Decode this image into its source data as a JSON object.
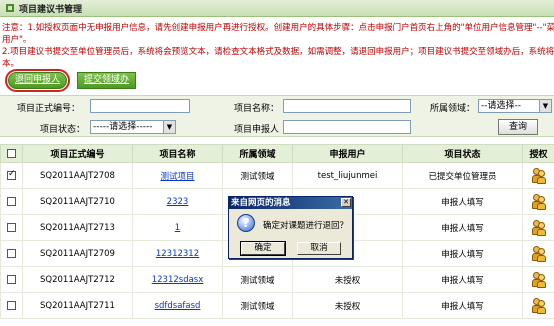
{
  "header": {
    "title": "项目建议书管理"
  },
  "notice": {
    "line1": "注意：1.如授权页面中无申报用户信息，请先创建申报用户再进行授权。创建用户的具体步骤：点击申报门户首页右上角的\"单位用户信息管理\"--\"菜单位申报",
    "line2": "用户\"。",
    "line3": "      2.项目建议书提交至单位管理员后，系统将会预览文本，请检查文本格式及数据，如需调整，请退回申报用户；项目建议书提交至领域办后，系统将",
    "line4": "本。"
  },
  "toolbar": {
    "return_label": "退回申报人",
    "submit_label": "提交领域办"
  },
  "search": {
    "code_label": "项目正式编号：",
    "name_label": "项目名称：",
    "field_label": "所属领域：",
    "field_select": "--请选择--",
    "status_label": "项目状态：",
    "status_select": "-----请选择-----",
    "applicant_label": "项目申报人",
    "query_label": "查询"
  },
  "table": {
    "headers": [
      "",
      "项目正式编号",
      "项目名称",
      "所属领域",
      "申报用户",
      "项目状态",
      "授权"
    ],
    "rows": [
      {
        "checked": true,
        "code": "SQ2011AAJT2708",
        "name": "测试项目",
        "field": "测试领域",
        "user": "test_liujunmei",
        "status": "已提交单位管理员"
      },
      {
        "checked": false,
        "code": "SQ2011AAJT2710",
        "name": "2323",
        "field": "测试领域",
        "user": "",
        "status": "申报人填写"
      },
      {
        "checked": false,
        "code": "SQ2011AAJT2713",
        "name": "1",
        "field": "",
        "user": "",
        "status": "申报人填写"
      },
      {
        "checked": false,
        "code": "SQ2011AAJT2709",
        "name": "12312312",
        "field": "",
        "user": "",
        "status": "申报人填写"
      },
      {
        "checked": false,
        "code": "SQ2011AAJT2712",
        "name": "12312sdasx",
        "field": "测试领域",
        "user": "未授权",
        "status": "申报人填写"
      },
      {
        "checked": false,
        "code": "SQ2011AAJT2711",
        "name": "sdfdsafasd",
        "field": "测试领域",
        "user": "未授权",
        "status": "申报人填写"
      }
    ]
  },
  "dialog": {
    "title": "来自网页的消息",
    "message": "确定对课题进行退回？",
    "ok_label": "确定",
    "cancel_label": "取消"
  },
  "icons": {
    "title_icon": "square-bullet-icon",
    "auth_icon": "users-icon",
    "dialog_icon": "question-icon"
  },
  "colors": {
    "accent_green": "#4c9a22",
    "notice_red": "#c00000",
    "link_blue": "#0b35c8"
  }
}
